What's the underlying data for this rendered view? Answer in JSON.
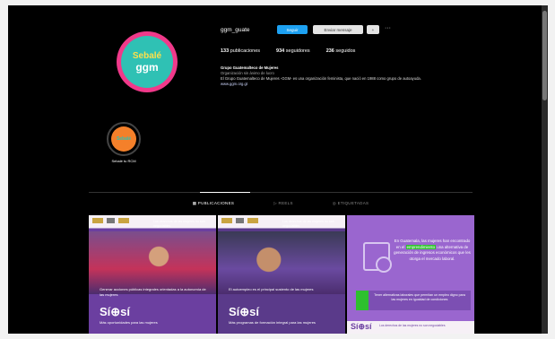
{
  "profile": {
    "avatar_line1": "Sebalé",
    "avatar_line2": "ggm",
    "username": "ggm_guate",
    "follow_label": "Seguir",
    "message_label": "Enviar mensaje",
    "suggest_label": "+",
    "more_label": "···",
    "stats": {
      "posts_num": "133",
      "posts_label": "publicaciones",
      "followers_num": "934",
      "followers_label": "seguidores",
      "following_num": "236",
      "following_label": "seguidos"
    },
    "bio": {
      "name": "Grupo Guatemalteco de Mujeres",
      "category": "Organización sin ánimo de lucro",
      "text": "El Grupo Guatemalteco de Mujeres -GGM- es una organización feminista, que nació en 1988 como grupo de autoayuda.",
      "link": "www.ggm.org.gt"
    }
  },
  "highlight": {
    "icon_text": "Sebalé",
    "label": "Sebalé tu RCM"
  },
  "tabs": [
    {
      "label": "PUBLICACIONES"
    },
    {
      "label": "REELS"
    },
    {
      "label": "ETIQUETADAS"
    }
  ],
  "posts": [
    {
      "header": "Los derechos de las mujeres no son negociables",
      "text": "Generar acciones públicas integrales orientadas a la autonomía de las mujeres",
      "sisi": "Sí⊕sí",
      "sub": "Más oportunidades para las mujeres"
    },
    {
      "header": "Los derechos de las mujeres no son negociables",
      "text": "El autoempleo es el principal sustento de las mujeres",
      "sisi": "Sí⊕sí",
      "sub": "Más programas de formación integral para las mujeres"
    },
    {
      "text_pre": "En Guatemala, las mujeres han encontrado en el",
      "text_hl": "emprendimiento",
      "text_post": "una alternativa de generación de ingresos económicos que les otorga el mercado laboral.",
      "green_text": "Tener alternativas laborales que permitan un empleo digno para las mujeres en igualdad de condiciones",
      "footer_sisi": "Sí⊕sí",
      "footer_text": "Los derechos de las mujeres no son negociables"
    }
  ]
}
